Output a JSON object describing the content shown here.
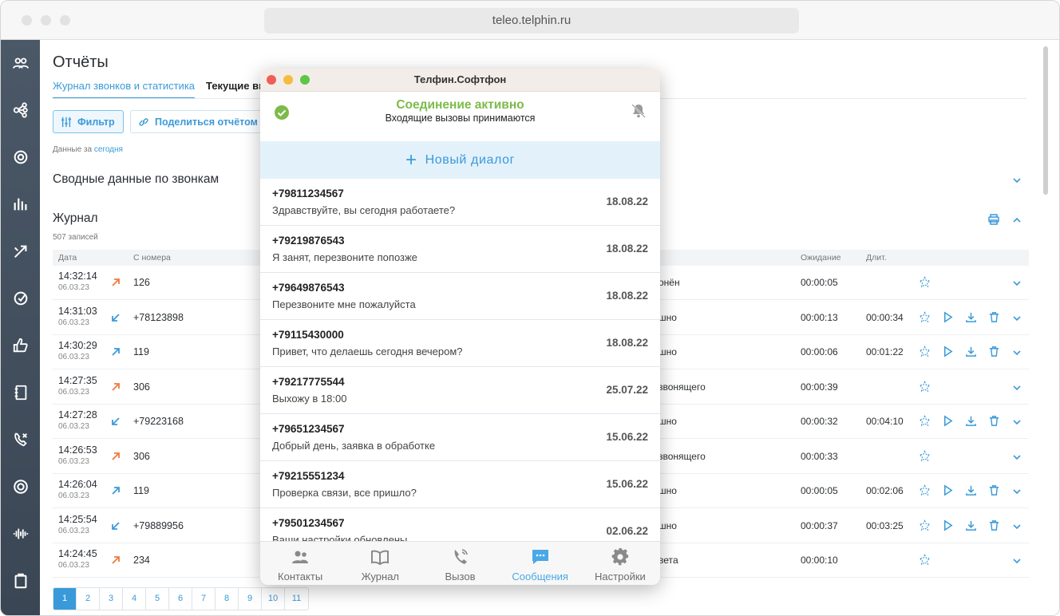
{
  "browser": {
    "url": "teleo.telphin.ru"
  },
  "page": {
    "title": "Отчёты",
    "tabs": [
      {
        "label": "Журнал звонков и статистика",
        "active": true
      },
      {
        "label": "Текущие вызовы",
        "active": false
      }
    ],
    "filter_label": "Фильтр",
    "share_label": "Поделиться отчётом",
    "data_for_prefix": "Данные за",
    "data_for_value": "сегодня",
    "summary_title": "Сводные данные по звонкам",
    "journal_title": "Журнал",
    "records_count": "507 записей",
    "columns": {
      "date": "Дата",
      "from": "С номера",
      "wait": "Ожидание",
      "dur": "Длит."
    },
    "rows": [
      {
        "time": "14:32:14",
        "date": "06.03.23",
        "dir": "out",
        "from": "126",
        "status": "онён",
        "wait": "00:00:05",
        "dur": "",
        "actions": false
      },
      {
        "time": "14:31:03",
        "date": "06.03.23",
        "dir": "in",
        "from": "+78123898",
        "status": "шно",
        "wait": "00:00:13",
        "dur": "00:00:34",
        "actions": true
      },
      {
        "time": "14:30:29",
        "date": "06.03.23",
        "dir": "int",
        "from": "119",
        "status": "шно",
        "wait": "00:00:06",
        "dur": "00:01:22",
        "actions": true
      },
      {
        "time": "14:27:35",
        "date": "06.03.23",
        "dir": "out",
        "from": "306",
        "status": "звонящего",
        "wait": "00:00:39",
        "dur": "",
        "actions": false
      },
      {
        "time": "14:27:28",
        "date": "06.03.23",
        "dir": "in",
        "from": "+79223168",
        "status": "шно",
        "wait": "00:00:32",
        "dur": "00:04:10",
        "actions": true
      },
      {
        "time": "14:26:53",
        "date": "06.03.23",
        "dir": "out",
        "from": "306",
        "status": "звонящего",
        "wait": "00:00:33",
        "dur": "",
        "actions": false
      },
      {
        "time": "14:26:04",
        "date": "06.03.23",
        "dir": "int",
        "from": "119",
        "status": "шно",
        "wait": "00:00:05",
        "dur": "00:02:06",
        "actions": true
      },
      {
        "time": "14:25:54",
        "date": "06.03.23",
        "dir": "in",
        "from": "+79889956",
        "status": "шно",
        "wait": "00:00:37",
        "dur": "00:03:25",
        "actions": true
      },
      {
        "time": "14:24:45",
        "date": "06.03.23",
        "dir": "out",
        "from": "234",
        "status": "ветa",
        "wait": "00:00:10",
        "dur": "",
        "actions": false
      }
    ],
    "pages": [
      "1",
      "2",
      "3",
      "4",
      "5",
      "6",
      "7",
      "8",
      "9",
      "10",
      "11"
    ]
  },
  "softphone": {
    "title": "Телфин.Софтфон",
    "status_title": "Соединение активно",
    "status_sub": "Входящие вызовы принимаются",
    "new_dialog": "Новый диалог",
    "messages": [
      {
        "number": "+79811234567",
        "text": "Здравствуйте, вы сегодня работаете?",
        "date": "18.08.22"
      },
      {
        "number": "+79219876543",
        "text": "Я занят, перезвоните попозже",
        "date": "18.08.22"
      },
      {
        "number": "+79649876543",
        "text": "Перезвоните мне пожалуйста",
        "date": "18.08.22"
      },
      {
        "number": "+79115430000",
        "text": "Привет, что делаешь сегодня вечером?",
        "date": "18.08.22"
      },
      {
        "number": "+79217775544",
        "text": "Выхожу в 18:00",
        "date": "25.07.22"
      },
      {
        "number": "+79651234567",
        "text": "Добрый день, заявка в обработке",
        "date": "15.06.22"
      },
      {
        "number": "+79215551234",
        "text": "Проверка связи, все пришло?",
        "date": "15.06.22"
      },
      {
        "number": "+79501234567",
        "text": "Ваши настройки обновлены",
        "date": "02.06.22"
      }
    ],
    "tabs": [
      {
        "label": "Контакты",
        "icon": "contacts-icon",
        "active": false
      },
      {
        "label": "Журнал",
        "icon": "book-icon",
        "active": false
      },
      {
        "label": "Вызов",
        "icon": "phone-icon",
        "active": false
      },
      {
        "label": "Сообщения",
        "icon": "chat-icon",
        "active": true
      },
      {
        "label": "Настройки",
        "icon": "gear-icon",
        "active": false
      }
    ]
  },
  "colors": {
    "accent": "#3a9ad9",
    "ok": "#7cbb4a",
    "outgoing": "#f07a3a",
    "sidebar": "#44505e"
  }
}
